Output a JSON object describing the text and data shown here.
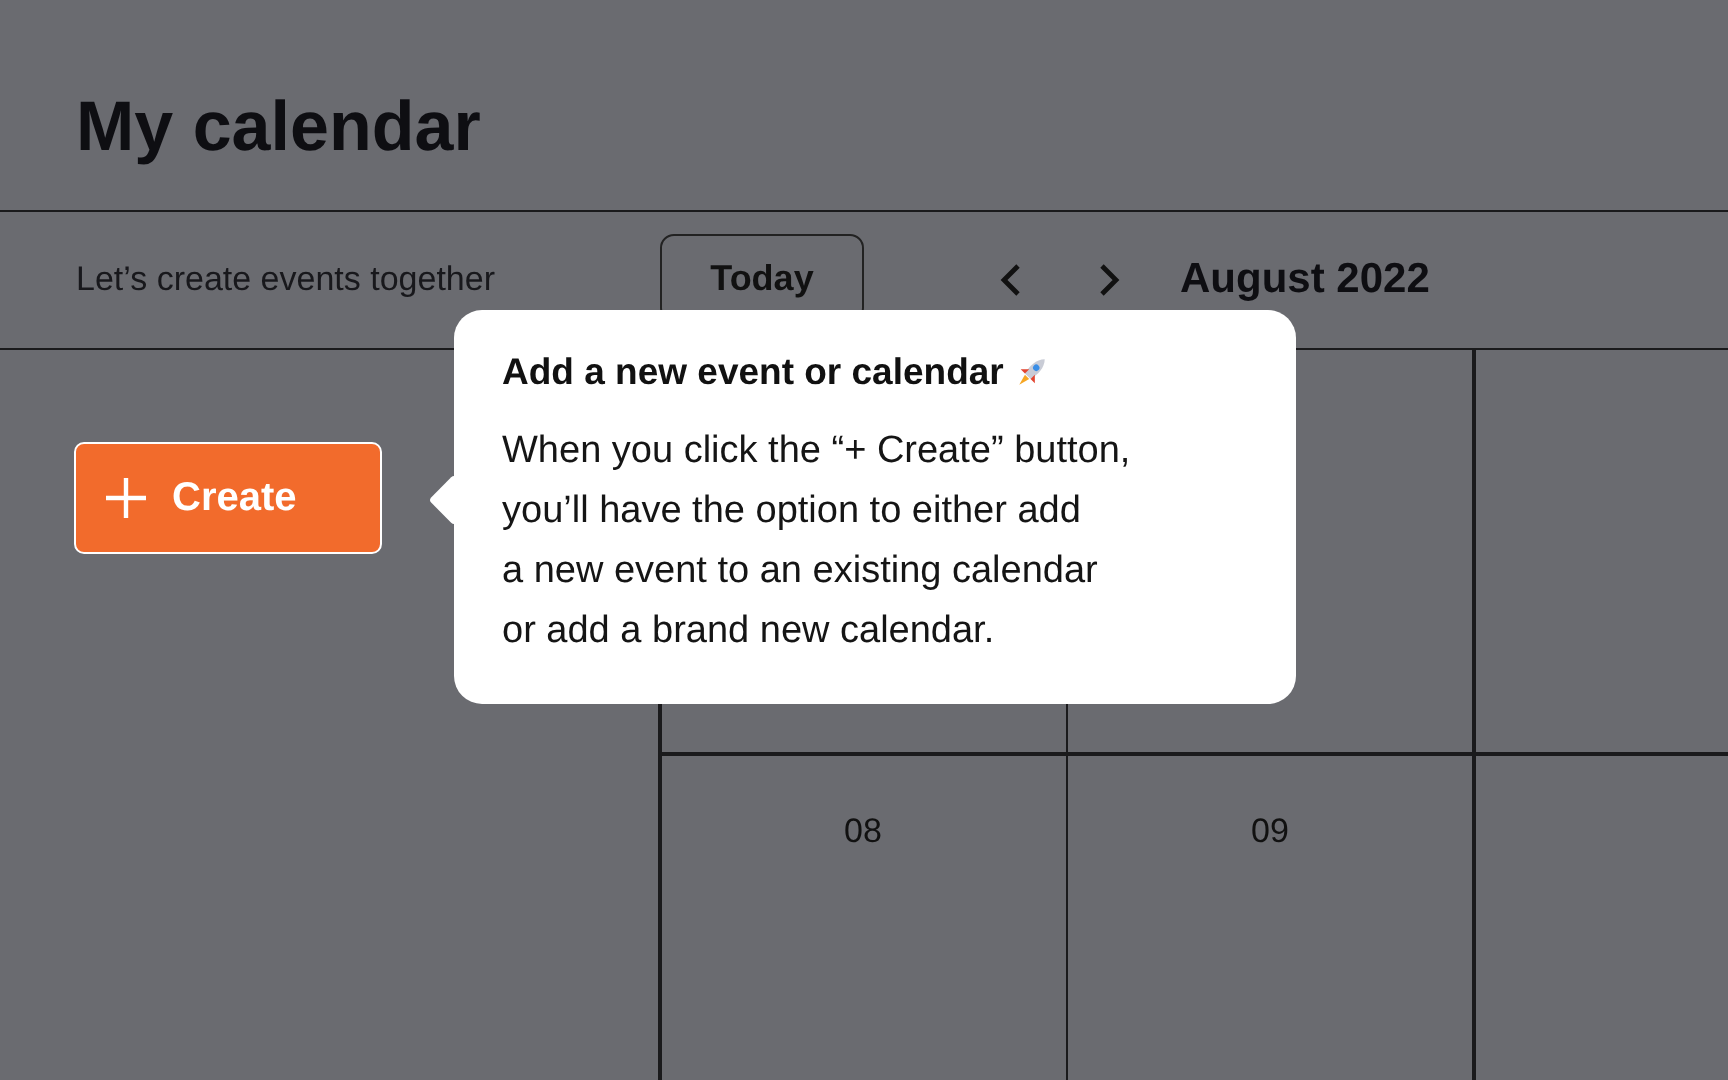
{
  "header": {
    "title": "My calendar"
  },
  "toolbar": {
    "subtitle": "Let’s create events together",
    "today_button": "Today",
    "month": "August 2022"
  },
  "create_button": {
    "label": "Create"
  },
  "calendar": {
    "days": [
      "08",
      "09"
    ]
  },
  "tooltip": {
    "title": "Add a new event or calendar",
    "body": "When you click the “+ Create” button,\nyou’ll have the option to either add\na new event to an existing calendar\nor add a brand new calendar."
  }
}
